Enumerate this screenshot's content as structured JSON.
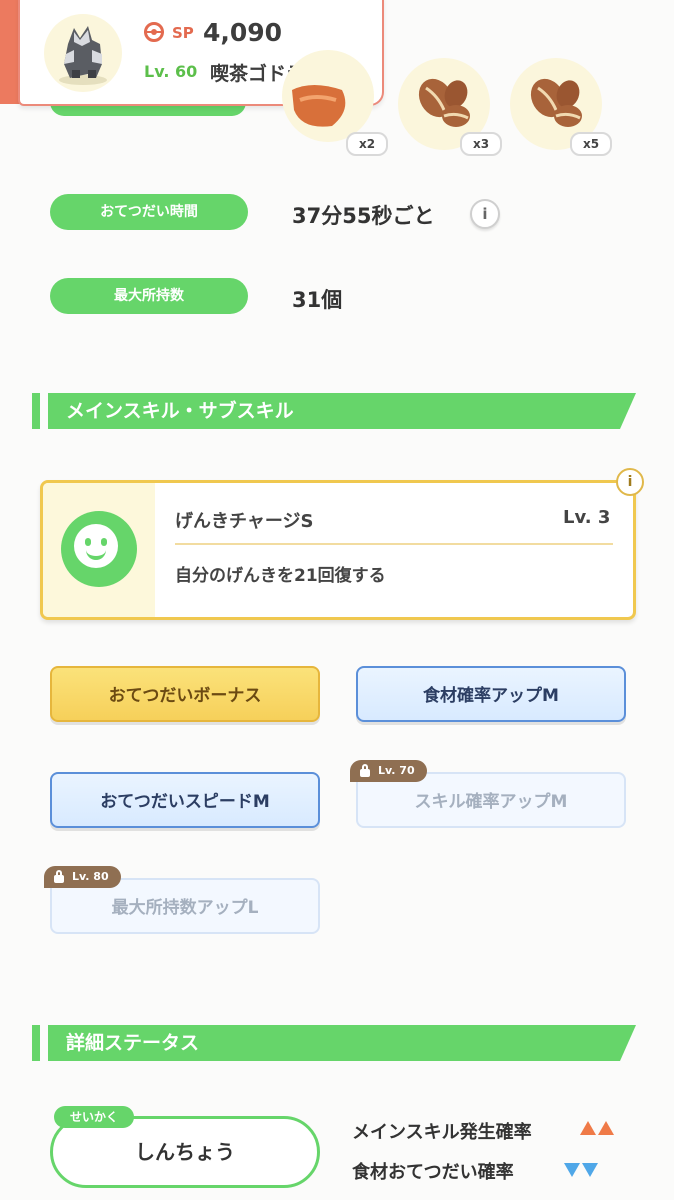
{
  "header": {
    "sp_label": "SP",
    "sp_value": "4,090",
    "level": "Lv. 60",
    "pokemon_name": "喫茶ゴドラ"
  },
  "ingredients": [
    {
      "icon": "ingredient-icon",
      "qty": "x2"
    },
    {
      "icon": "coffee-beans-icon",
      "qty": "x3"
    },
    {
      "icon": "coffee-beans-icon",
      "qty": "x5"
    }
  ],
  "stats": {
    "help_time_label": "おてつだい時間",
    "help_time_value": "37分55秒ごと",
    "info_glyph": "i",
    "max_carry_label": "最大所持数",
    "max_carry_value": "31個"
  },
  "skills_section": {
    "title": "メインスキル・サブスキル",
    "main_skill": {
      "name": "げんきチャージS",
      "level": "Lv. 3",
      "description": "自分のげんきを21回復する",
      "icon": "smiley-icon"
    },
    "sub_skills": [
      {
        "label": "おてつだいボーナス",
        "state": "gold"
      },
      {
        "label": "食材確率アップM",
        "state": "blue"
      },
      {
        "label": "おてつだいスピードM",
        "state": "blue"
      },
      {
        "label": "スキル確率アップM",
        "state": "locked",
        "unlock": "Lv. 70"
      },
      {
        "label": "最大所持数アップL",
        "state": "locked",
        "unlock": "Lv. 80"
      }
    ]
  },
  "detail_section": {
    "title": "詳細ステータス",
    "nature_tag": "せいかく",
    "nature_value": "しんちょう",
    "effects": [
      {
        "label": "メインスキル発生確率",
        "direction": "up"
      },
      {
        "label": "食材おてつだい確率",
        "direction": "down"
      }
    ]
  },
  "colors": {
    "accent_green": "#66d56a",
    "header_red": "#ec7a5f",
    "up_arrow": "#ef7a47",
    "down_arrow": "#4fa7e8"
  }
}
